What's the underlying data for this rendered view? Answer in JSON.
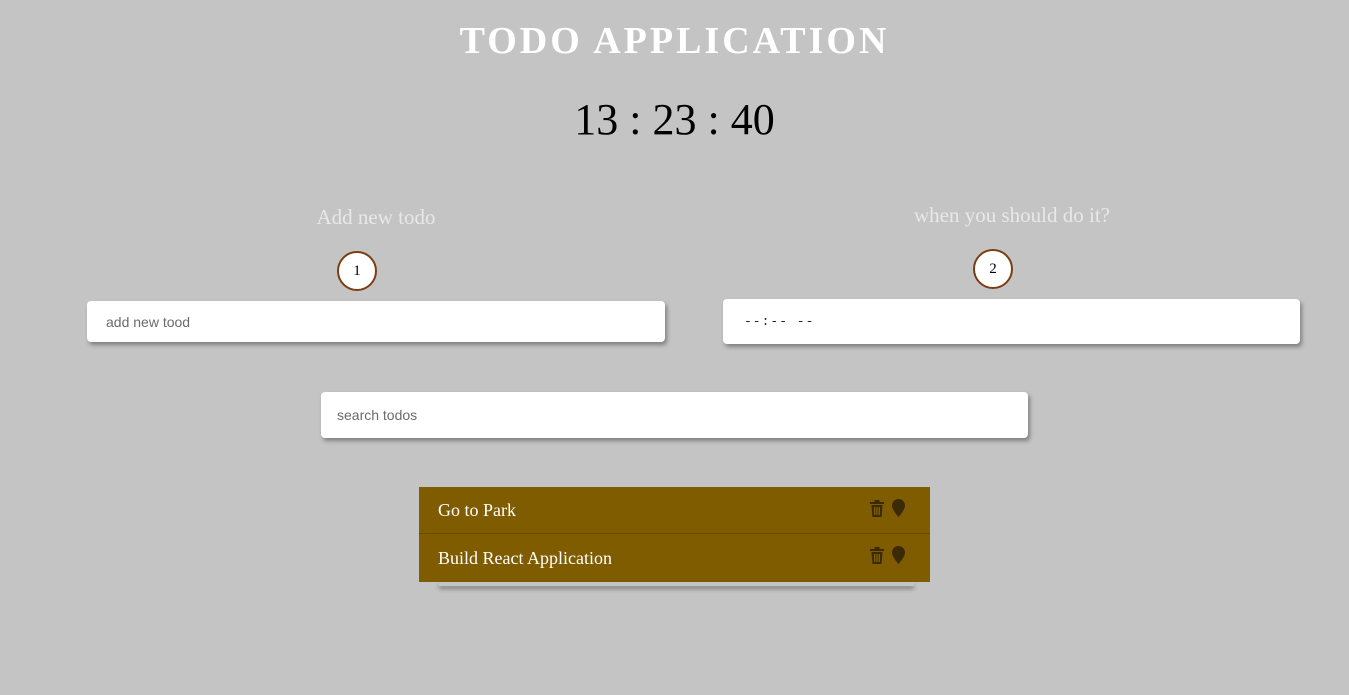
{
  "header": {
    "title": "TODO APPLICATION",
    "clock": "13 : 23 : 40"
  },
  "new_todo": {
    "label": "Add new todo",
    "step": "1",
    "placeholder": "add new tood"
  },
  "schedule": {
    "label": "when you should do it?",
    "step": "2",
    "time_value": "--:-- --"
  },
  "search": {
    "placeholder": "search todos"
  },
  "todos": [
    {
      "text": "Go to Park",
      "delete_icon": "trash-icon",
      "location_icon": "map-marker-icon"
    },
    {
      "text": "Build React Application",
      "delete_icon": "trash-icon",
      "location_icon": "map-marker-icon"
    }
  ],
  "colors": {
    "background": "#c4c4c4",
    "todo_background": "#7f5c00",
    "icon_color": "#3a2a06",
    "step_border": "#7a3e12"
  }
}
